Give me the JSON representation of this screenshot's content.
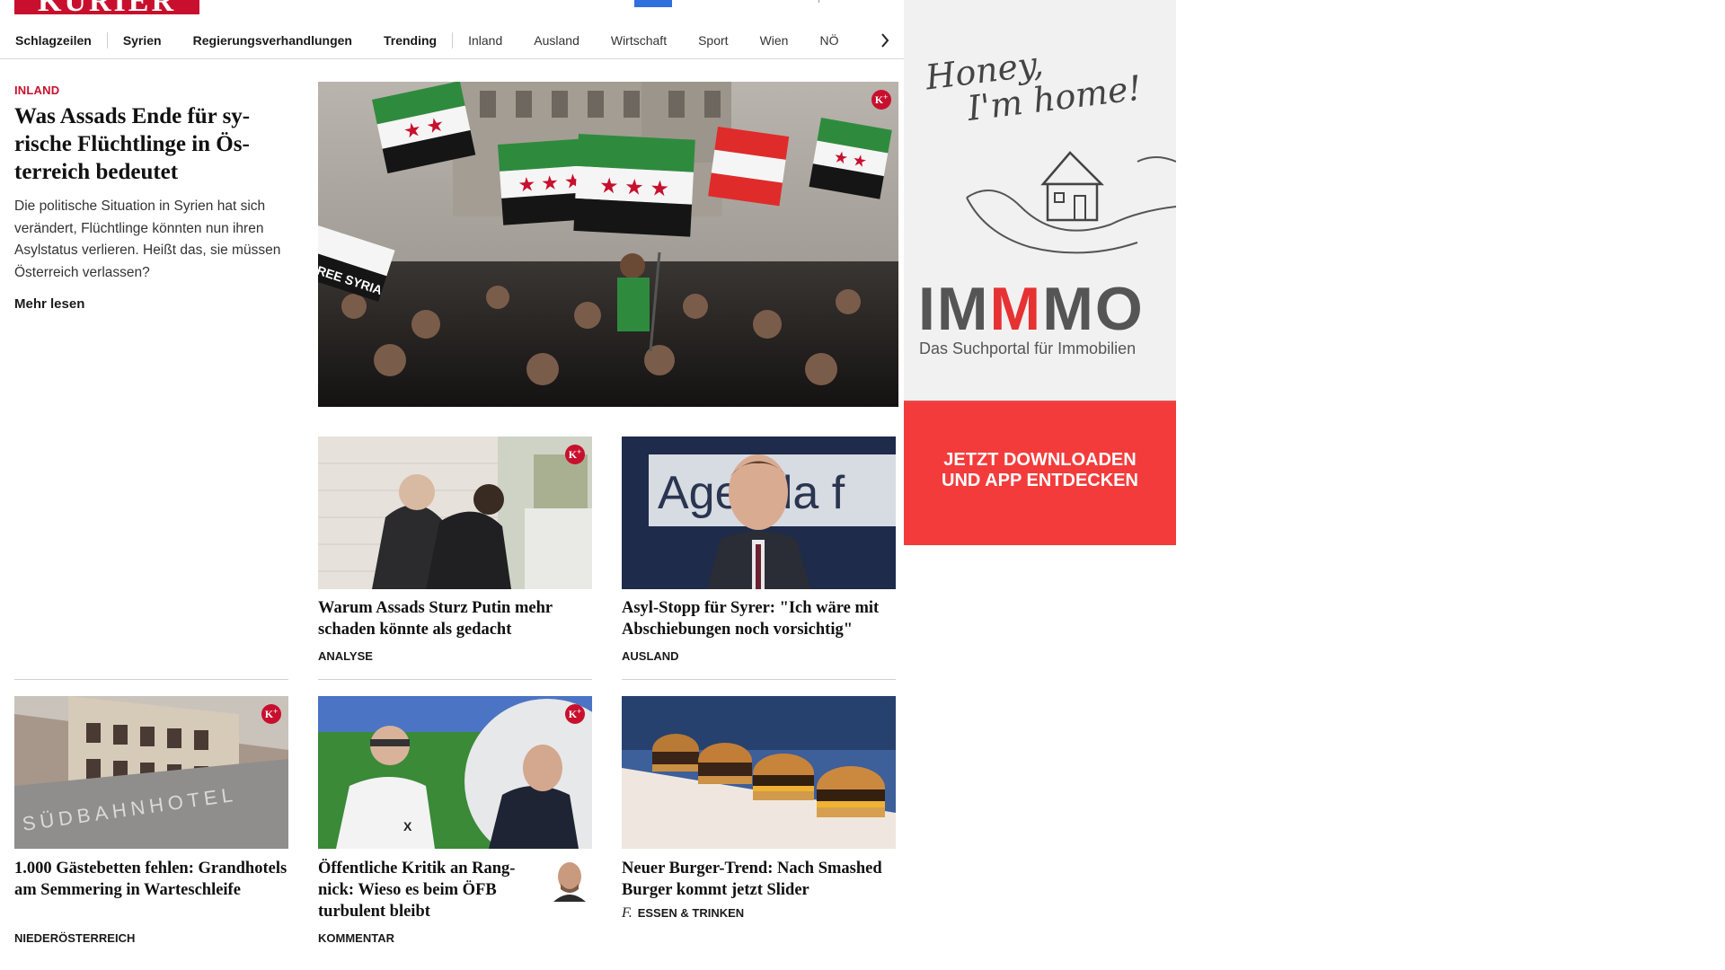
{
  "header": {
    "logo_text": "KURIER"
  },
  "nav": {
    "items": [
      {
        "label": "Schlagzeilen",
        "style": "bold"
      },
      {
        "label": "Syrien",
        "style": "bold"
      },
      {
        "label": "Regierungsverhandlungen",
        "style": "bold"
      },
      {
        "label": "Trending",
        "style": "bold"
      },
      {
        "label": "Inland",
        "style": "light"
      },
      {
        "label": "Ausland",
        "style": "light"
      },
      {
        "label": "Wirtschaft",
        "style": "light"
      },
      {
        "label": "Sport",
        "style": "light"
      },
      {
        "label": "Wien",
        "style": "light"
      },
      {
        "label": "NÖ",
        "style": "light"
      }
    ],
    "next_icon": "chevron-right-icon"
  },
  "lead": {
    "kicker": "INLAND",
    "title": "Was Assads Ende für sy­rische Flüchtlinge in Ös­terreich bedeutet",
    "summary": "Die politische Situation in Syrien hat sich verändert, Flüchtlinge könnten nun ihren Asylstatus verlieren. Heißt das, sie müssen Österreich verlassen?",
    "more_label": "Mehr lesen",
    "premium_badge": "K+"
  },
  "cards": [
    {
      "title": "Warum Assads Sturz Putin mehr schaden könnte als gedacht",
      "category": "ANALYSE",
      "premium": true
    },
    {
      "title": "Asyl-Stopp für Syrer: \"Ich wäre mit Abschiebungen noch vorsichtig\"",
      "category": "AUSLAND",
      "premium": false
    },
    {
      "title": "1.000 Gästebetten fehlen: Grandho­tels am Semmering in Warteschleife",
      "category": "NIEDERÖSTERREICH",
      "premium": true,
      "image_sign": "SÜDBAHNHOTEL"
    },
    {
      "title": "Öffentliche Kritik an Rang­nick: Wieso es beim ÖFB turbulent bleibt",
      "category": "KOMMENTAR",
      "premium": true
    },
    {
      "title": "Neuer Burger-Trend: Nach Smas­hed Burger kommt jetzt Slider",
      "category": "ESSEN & TRINKEN",
      "premium": false,
      "category_icon": "f."
    }
  ],
  "lead_image": {
    "flag_text": "FREE SYRIA"
  },
  "card_image_2": {
    "sign_text": "Agenda f"
  },
  "ad": {
    "script_line1": "Honey,",
    "script_line2": "I'm home!",
    "brand_a": "IM",
    "brand_b": "M",
    "brand_c": "MO",
    "subtitle": "Das Suchportal für Immobilien",
    "cta_line1": "JETZT DOWNLOADEN",
    "cta_line2": "UND APP ENTDECKEN",
    "accent": "#e63232"
  },
  "colors": {
    "brand": "#c8102e",
    "ad_red": "#f43b3b"
  }
}
